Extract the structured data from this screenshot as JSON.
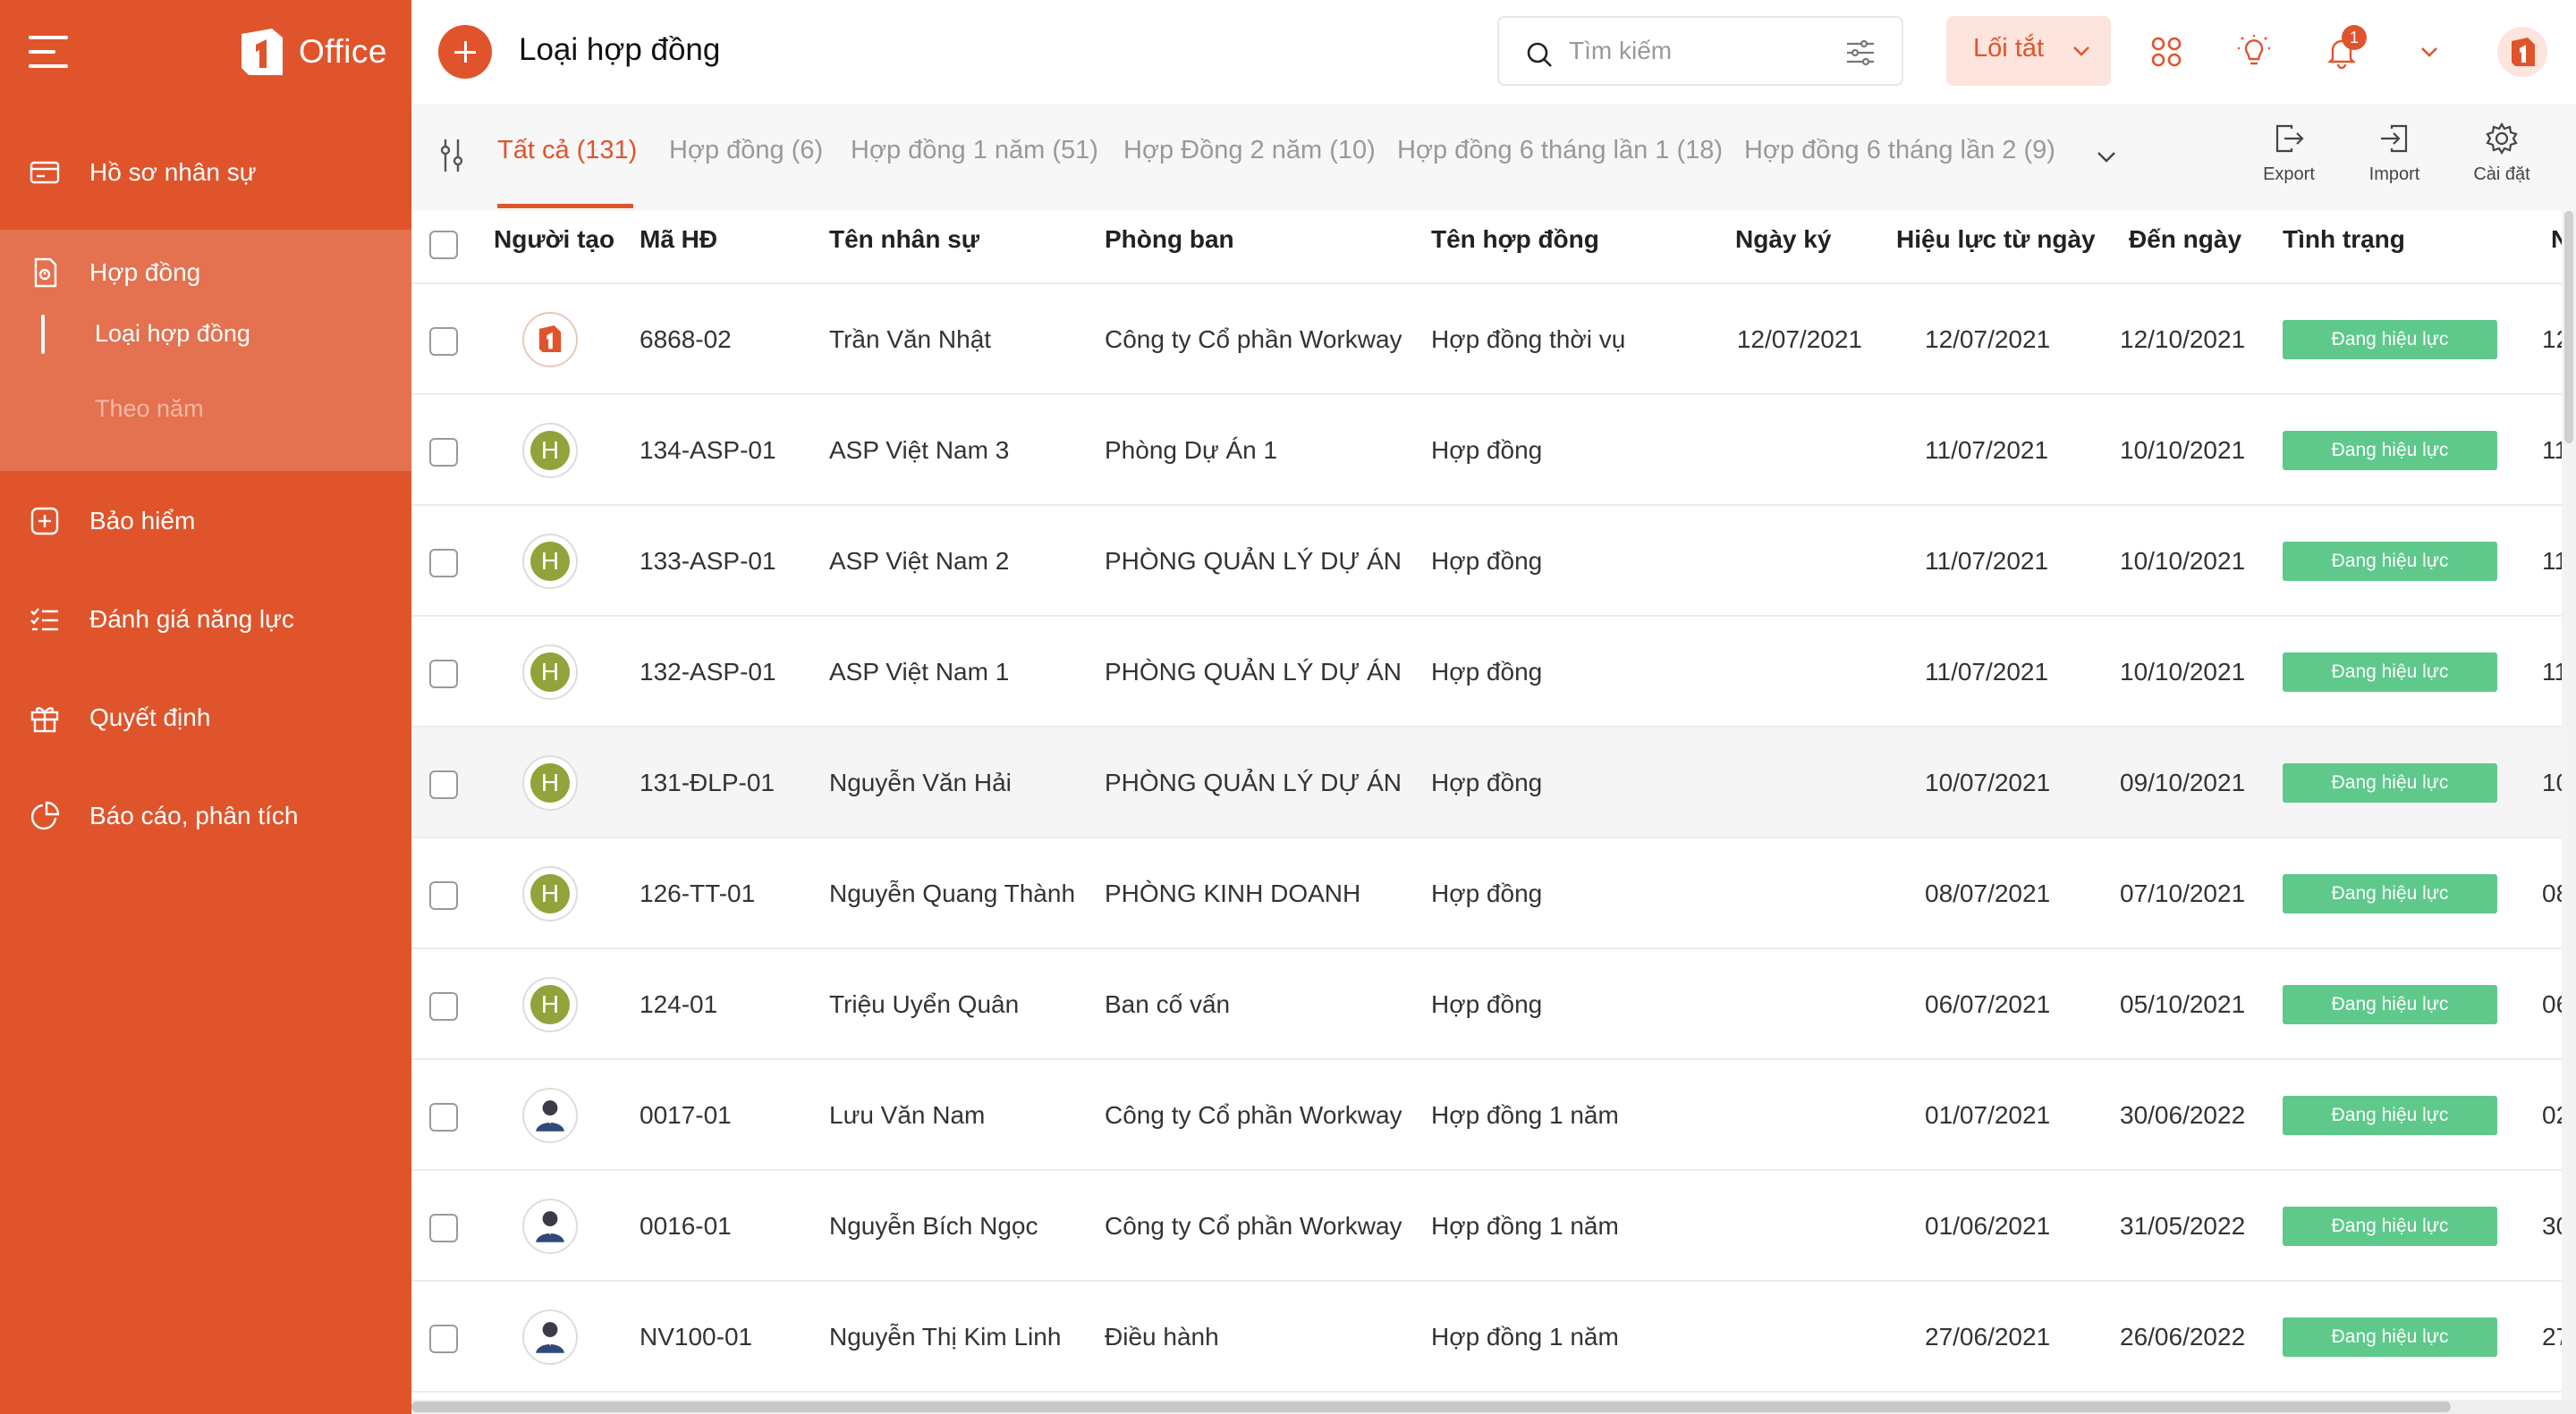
{
  "brand": {
    "name": "Office",
    "accent": "#e0542c",
    "submenu_bg": "#e4714f",
    "status_color": "#5ec98b"
  },
  "sidebar": {
    "items": [
      {
        "label": "Hồ sơ nhân sự",
        "icon": "id-card-icon"
      },
      {
        "label": "Hợp đồng",
        "icon": "contract-icon",
        "expanded": true,
        "children": [
          {
            "label": "Loại hợp đồng",
            "active": true
          },
          {
            "label": "Theo năm",
            "active": false
          }
        ]
      },
      {
        "label": "Bảo hiểm",
        "icon": "plus-square-icon"
      },
      {
        "label": "Đánh giá năng lực",
        "icon": "checklist-icon"
      },
      {
        "label": "Quyết định",
        "icon": "gift-icon"
      },
      {
        "label": "Báo cáo, phân tích",
        "icon": "pie-chart-icon"
      }
    ]
  },
  "header": {
    "title": "Loại hợp đồng",
    "search_placeholder": "Tìm kiếm",
    "shortcut_label": "Lối tắt",
    "notification_count": "1"
  },
  "tabs": [
    {
      "label": "Tất cả (131)",
      "active": true
    },
    {
      "label": "Hợp đồng (6)"
    },
    {
      "label": "Hợp đồng 1 năm (51)"
    },
    {
      "label": "Hợp Đồng 2 năm (10)"
    },
    {
      "label": "Hợp đồng 6 tháng lần 1 (18)"
    },
    {
      "label": "Hợp đồng 6 tháng lần 2 (9)"
    }
  ],
  "tools": {
    "export": "Export",
    "import": "Import",
    "settings": "Cài đặt"
  },
  "table": {
    "columns": [
      "Người tạo",
      "Mã HĐ",
      "Tên nhân sự",
      "Phòng ban",
      "Tên hợp đồng",
      "Ngày ký",
      "Hiệu lực từ ngày",
      "Đến ngày",
      "Tình trạng",
      "N"
    ],
    "rows": [
      {
        "avatar": "logo",
        "avatar_text": "",
        "code": "6868-02",
        "name": "Trần Văn Nhật",
        "department": "Công ty Cổ phần Workway",
        "contract": "Hợp đồng thời vụ",
        "signed": "12/07/2021",
        "from": "12/07/2021",
        "to": "12/10/2021",
        "status": "Đang hiệu lực",
        "next": "12"
      },
      {
        "avatar": "letter",
        "avatar_text": "H",
        "code": "134-ASP-01",
        "name": "ASP Việt Nam 3",
        "department": "Phòng Dự Án 1",
        "contract": "Hợp đồng",
        "signed": "",
        "from": "11/07/2021",
        "to": "10/10/2021",
        "status": "Đang hiệu lực",
        "next": "11"
      },
      {
        "avatar": "letter",
        "avatar_text": "H",
        "code": "133-ASP-01",
        "name": "ASP Việt Nam 2",
        "department": "PHÒNG QUẢN LÝ DỰ ÁN",
        "contract": "Hợp đồng",
        "signed": "",
        "from": "11/07/2021",
        "to": "10/10/2021",
        "status": "Đang hiệu lực",
        "next": "11"
      },
      {
        "avatar": "letter",
        "avatar_text": "H",
        "code": "132-ASP-01",
        "name": "ASP Việt Nam 1",
        "department": "PHÒNG QUẢN LÝ DỰ ÁN",
        "contract": "Hợp đồng",
        "signed": "",
        "from": "11/07/2021",
        "to": "10/10/2021",
        "status": "Đang hiệu lực",
        "next": "11"
      },
      {
        "avatar": "letter",
        "avatar_text": "H",
        "code": "131-ĐLP-01",
        "name": "Nguyễn Văn Hải",
        "department": "PHÒNG QUẢN LÝ DỰ ÁN",
        "contract": "Hợp đồng",
        "signed": "",
        "from": "10/07/2021",
        "to": "09/10/2021",
        "status": "Đang hiệu lực",
        "next": "10"
      },
      {
        "avatar": "letter",
        "avatar_text": "H",
        "code": "126-TT-01",
        "name": "Nguyễn Quang Thành",
        "department": "PHÒNG KINH DOANH",
        "contract": "Hợp đồng",
        "signed": "",
        "from": "08/07/2021",
        "to": "07/10/2021",
        "status": "Đang hiệu lực",
        "next": "08"
      },
      {
        "avatar": "letter",
        "avatar_text": "H",
        "code": "124-01",
        "name": "Triệu Uyển Quân",
        "department": "Ban cố vấn",
        "contract": "Hợp đồng",
        "signed": "",
        "from": "06/07/2021",
        "to": "05/10/2021",
        "status": "Đang hiệu lực",
        "next": "06"
      },
      {
        "avatar": "photo",
        "avatar_text": "",
        "code": "0017-01",
        "name": "Lưu Văn Nam",
        "department": "Công ty Cổ phần Workway",
        "contract": "Hợp đồng 1 năm",
        "signed": "",
        "from": "01/07/2021",
        "to": "30/06/2022",
        "status": "Đang hiệu lực",
        "next": "02"
      },
      {
        "avatar": "photo",
        "avatar_text": "",
        "code": "0016-01",
        "name": "Nguyễn Bích Ngọc",
        "department": "Công ty Cổ phần Workway",
        "contract": "Hợp đồng 1 năm",
        "signed": "",
        "from": "01/06/2021",
        "to": "31/05/2022",
        "status": "Đang hiệu lực",
        "next": "30"
      },
      {
        "avatar": "photo",
        "avatar_text": "",
        "code": "NV100-01",
        "name": "Nguyễn Thị Kim Linh",
        "department": "Điều hành",
        "contract": "Hợp đồng 1 năm",
        "signed": "",
        "from": "27/06/2021",
        "to": "26/06/2022",
        "status": "Đang hiệu lực",
        "next": "27"
      }
    ]
  }
}
